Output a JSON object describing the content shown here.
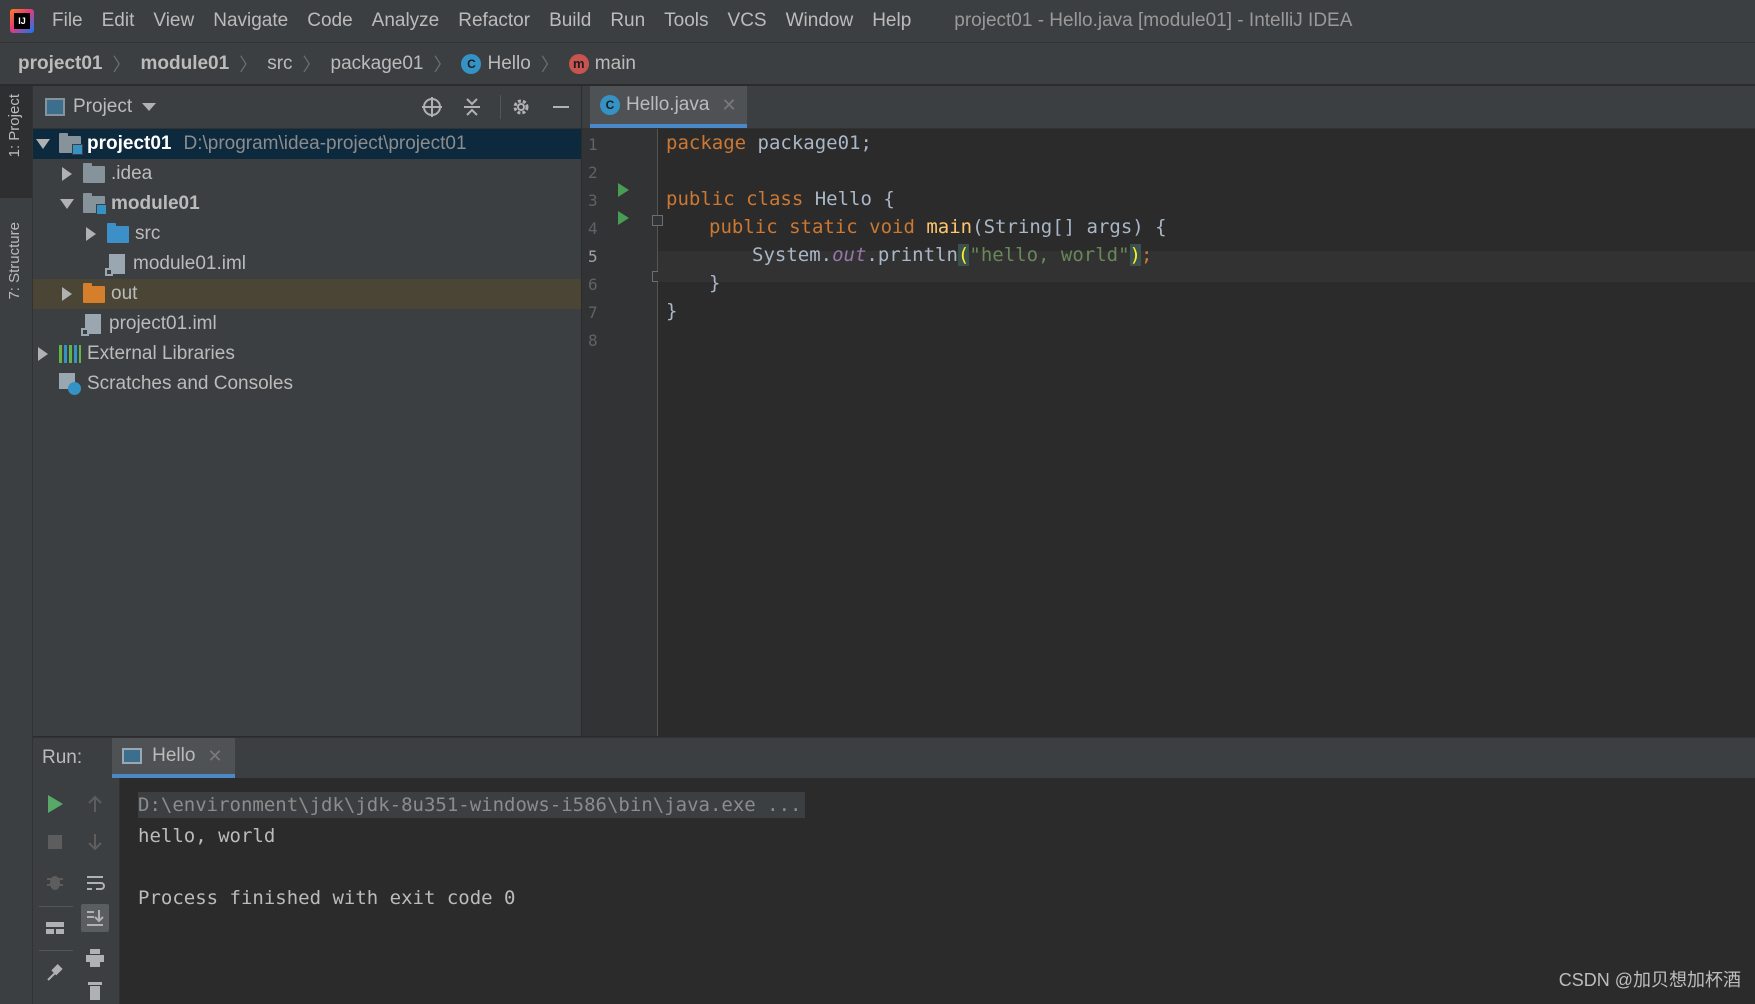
{
  "menubar": {
    "items": [
      "File",
      "Edit",
      "View",
      "Navigate",
      "Code",
      "Analyze",
      "Refactor",
      "Build",
      "Run",
      "Tools",
      "VCS",
      "Window",
      "Help"
    ],
    "window_title": "project01 - Hello.java [module01] - IntelliJ IDEA"
  },
  "breadcrumb": [
    "project01",
    "module01",
    "src",
    "package01",
    "Hello",
    "main"
  ],
  "left_strip": {
    "project_tab": "1: Project",
    "structure_tab": "7: Structure"
  },
  "project_panel": {
    "view_label": "Project",
    "tree": [
      {
        "label": "project01",
        "path": "D:\\program\\idea-project\\project01"
      },
      {
        "label": ".idea"
      },
      {
        "label": "module01"
      },
      {
        "label": "src"
      },
      {
        "label": "module01.iml"
      },
      {
        "label": "out"
      },
      {
        "label": "project01.iml"
      },
      {
        "label": "External Libraries"
      },
      {
        "label": "Scratches and Consoles"
      }
    ]
  },
  "editor": {
    "tab_label": "Hello.java",
    "line_numbers": [
      "1",
      "2",
      "3",
      "4",
      "5",
      "6",
      "7",
      "8"
    ],
    "code": {
      "l1_kw": "package",
      "l1_rest": " package01;",
      "l3_kw": "public class",
      "l3_rest": " Hello {",
      "l4_kw": "public static void",
      "l4_fn": "main",
      "l4_rest": "(String[] args) {",
      "l5_a": "System.",
      "l5_field": "out",
      "l5_b": ".println",
      "l5_open": "(",
      "l5_str": "\"hello, world\"",
      "l5_close": ")",
      "l5_semi": ";",
      "l6": "}",
      "l7": "}"
    }
  },
  "run_panel": {
    "label": "Run:",
    "tab_label": "Hello",
    "console": [
      "D:\\environment\\jdk\\jdk-8u351-windows-i586\\bin\\java.exe ...",
      "hello, world",
      "",
      "Process finished with exit code 0"
    ]
  },
  "watermark": "CSDN @加贝想加杯酒"
}
